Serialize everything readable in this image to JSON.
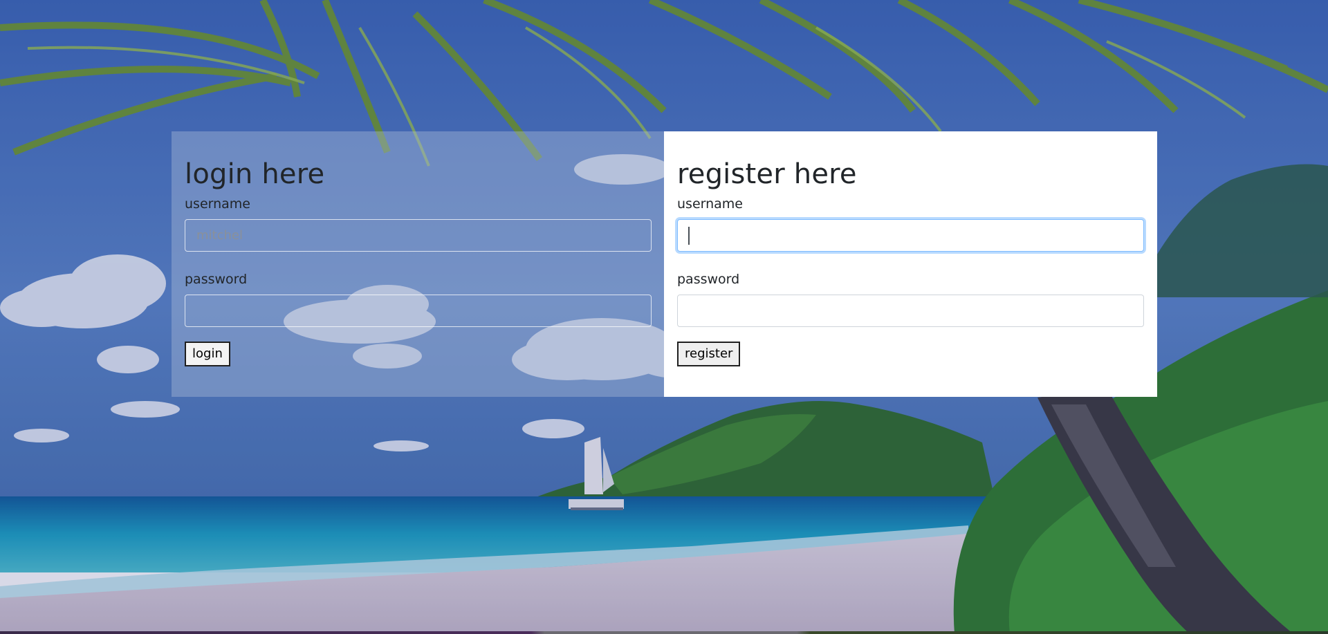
{
  "login": {
    "title": "login here",
    "username_label": "username",
    "username_placeholder": "mitchel",
    "password_label": "password",
    "button_label": "login"
  },
  "register": {
    "title": "register here",
    "username_label": "username",
    "username_value": "",
    "password_label": "password",
    "button_label": "register"
  },
  "background": {
    "scene": "tropical-beach-with-palm-trees-and-sailboat",
    "sky_color": "#2f5fae",
    "sea_color": "#1aa3c4",
    "sand_color": "#d9cfd6",
    "foliage_color": "#2f7d2a"
  }
}
